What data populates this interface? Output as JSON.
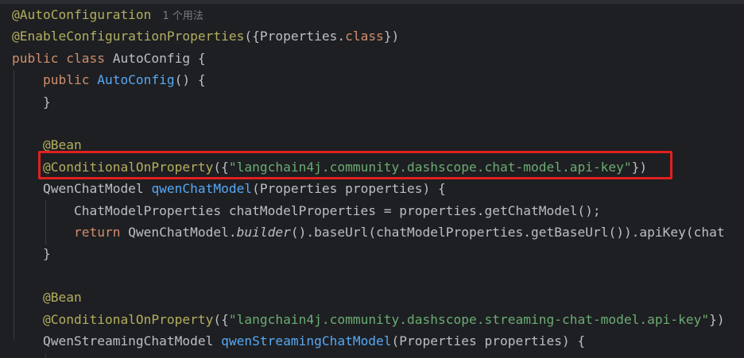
{
  "editor": {
    "usage_hint": "1 个用法",
    "lines": [
      [
        {
          "t": "@AutoConfiguration",
          "c": "ann"
        }
      ],
      [
        {
          "t": "@EnableConfigurationProperties",
          "c": "ann"
        },
        {
          "t": "({Properties.",
          "c": "plain"
        },
        {
          "t": "class",
          "c": "kw"
        },
        {
          "t": "})",
          "c": "plain"
        }
      ],
      [
        {
          "t": "public class ",
          "c": "kw"
        },
        {
          "t": "AutoConfig {",
          "c": "plain"
        }
      ],
      [
        {
          "t": "    public ",
          "c": "kw"
        },
        {
          "t": "AutoConfig",
          "c": "fn"
        },
        {
          "t": "() {",
          "c": "plain"
        }
      ],
      [
        {
          "t": "    }",
          "c": "plain"
        }
      ],
      [],
      [
        {
          "t": "    @Bean",
          "c": "ann"
        }
      ],
      [
        {
          "t": "    @ConditionalOnProperty",
          "c": "ann"
        },
        {
          "t": "({",
          "c": "plain"
        },
        {
          "t": "\"langchain4j.community.dashscope.chat-model.api-key\"",
          "c": "str"
        },
        {
          "t": "})",
          "c": "plain"
        }
      ],
      [
        {
          "t": "    QwenChatModel ",
          "c": "plain"
        },
        {
          "t": "qwenChatModel",
          "c": "fn"
        },
        {
          "t": "(Properties properties) {",
          "c": "plain"
        }
      ],
      [
        {
          "t": "        ChatModelProperties chatModelProperties = properties.getChatModel();",
          "c": "plain"
        }
      ],
      [
        {
          "t": "        return ",
          "c": "kw"
        },
        {
          "t": "QwenChatModel.",
          "c": "plain"
        },
        {
          "t": "builder",
          "c": "plain italic"
        },
        {
          "t": "().baseUrl(chatModelProperties.getBaseUrl()).apiKey(chat",
          "c": "plain"
        }
      ],
      [
        {
          "t": "    }",
          "c": "plain"
        }
      ],
      [],
      [
        {
          "t": "    @Bean",
          "c": "ann"
        }
      ],
      [
        {
          "t": "    @ConditionalOnProperty",
          "c": "ann"
        },
        {
          "t": "({",
          "c": "plain"
        },
        {
          "t": "\"langchain4j.community.dashscope.streaming-chat-model.api-key\"",
          "c": "str"
        },
        {
          "t": "})",
          "c": "plain"
        }
      ],
      [
        {
          "t": "    QwenStreamingChatModel ",
          "c": "plain"
        },
        {
          "t": "qwenStreamingChatModel",
          "c": "fn"
        },
        {
          "t": "(Properties properties) {",
          "c": "plain"
        }
      ],
      [
        {
          "t": "        ",
          "c": "plain"
        }
      ]
    ]
  }
}
